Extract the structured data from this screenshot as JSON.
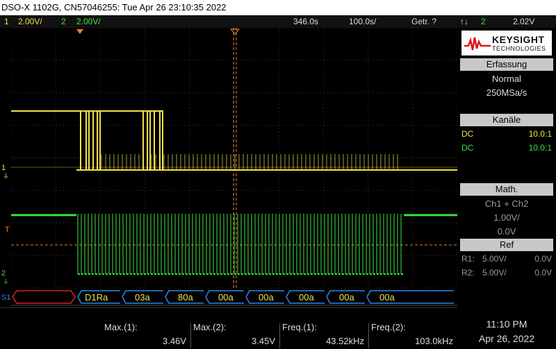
{
  "window_title": "DSO-X 1102G, CN57046255: Tue Apr 26 23:10:35 2022",
  "status": {
    "ch1_num": "1",
    "ch1_scale": "2.00V/",
    "ch2_num": "2",
    "ch2_scale": "2.00V/",
    "time_delay": "346.0s",
    "time_scale": "100.0s/",
    "trigger_mode": "Getr. ?",
    "trigger_channel": "2",
    "trigger_level": "2.02V"
  },
  "colors": {
    "ch1": "#f2e24a",
    "ch2": "#3fe03f",
    "cursor": "#e8822a",
    "bus_left": "#e02020",
    "bus": "#2a8ae8"
  },
  "markers": {
    "ch1_label": "1",
    "trigger_label": "T",
    "ch2_label": "2",
    "serial_label": "S1"
  },
  "decode": [
    "D1Ra",
    "03a",
    "80a",
    "00a",
    "00a",
    "00a",
    "00a",
    "00a"
  ],
  "panel": {
    "brand": "KEYSIGHT",
    "brand_sub": "TECHNOLOGIES",
    "acq_title": "Erfassung",
    "acq_mode": "Normal",
    "acq_rate": "250MSa/s",
    "channels_title": "Kanäle",
    "ch1_coupling": "DC",
    "ch1_probe": "10.0:1",
    "ch2_coupling": "DC",
    "ch2_probe": "10.0:1",
    "math_title": "Math.",
    "math_func": "Ch1 + Ch2",
    "math_scale": "1.00V/",
    "math_offset": "0.0V",
    "ref_title": "Ref",
    "r1_label": "R1:",
    "r1_scale": "5.00V/",
    "r1_offset": "0.0V",
    "r2_label": "R2:",
    "r2_scale": "5.00V/",
    "r2_offset": "0.0V"
  },
  "measurements": [
    {
      "label": "Max.(1):",
      "value": "3.46V"
    },
    {
      "label": "Max.(2):",
      "value": "3.45V"
    },
    {
      "label": "Freq.(1):",
      "value": "43.52kHz"
    },
    {
      "label": "Freq.(2):",
      "value": "103.0kHz"
    }
  ],
  "clock": {
    "time": "11:10 PM",
    "date": "Apr 26, 2022"
  }
}
